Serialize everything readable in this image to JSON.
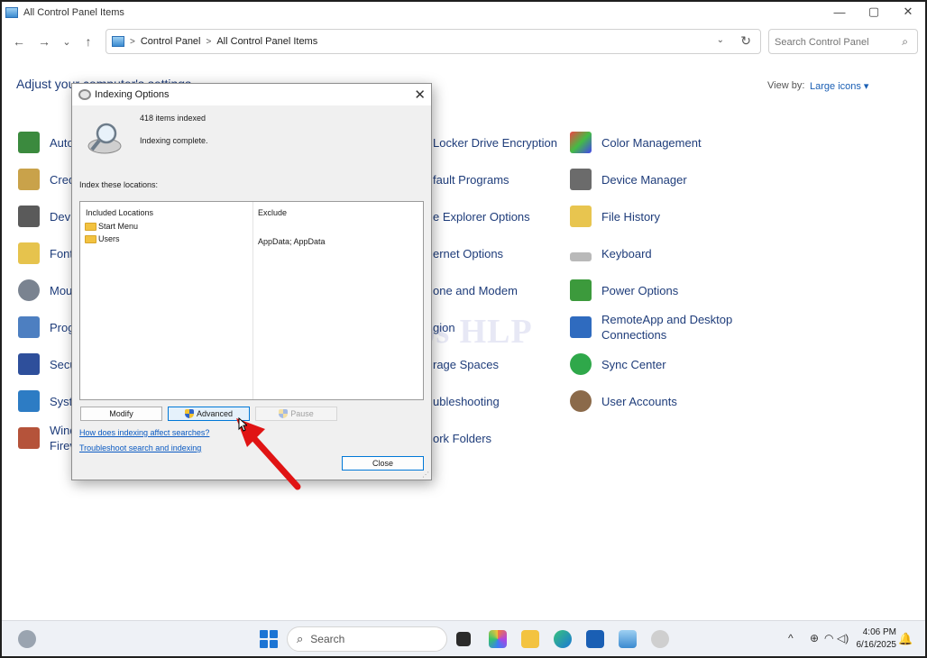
{
  "window": {
    "title": "All Control Panel Items",
    "controls": {
      "minimize": "—",
      "maximize": "▢",
      "close": "✕"
    }
  },
  "nav": {
    "back": "←",
    "forward": "→",
    "recent": "⌄",
    "up": "↑",
    "breadcrumb": [
      "Control Panel",
      "All Control Panel Items"
    ],
    "separator": ">",
    "dropdown": "⌄",
    "refresh": "↻",
    "search_placeholder": "Search Control Panel",
    "search_icon": "⌕"
  },
  "header": {
    "adjust": "Adjust your computer's settings",
    "view_by_label": "View by:",
    "view_by_value": "Large icons ▾"
  },
  "items": {
    "col1": [
      "Auto",
      "Cred",
      "Devi",
      "Font",
      "Mou",
      "Prog",
      "Secu",
      "Syst",
      "Wind\nFirev"
    ],
    "col2": [
      "Locker Drive Encryption",
      "fault Programs",
      "e Explorer Options",
      "ernet Options",
      "one and Modem",
      "gion",
      "rage Spaces",
      "ubleshooting",
      "ork Folders"
    ],
    "col3": [
      "Color Management",
      "Device Manager",
      "File History",
      "Keyboard",
      "Power Options",
      "RemoteApp and Desktop\nConnections",
      "Sync Center",
      "User Accounts"
    ]
  },
  "watermark": "IT Pros HLP",
  "dialog": {
    "title": "Indexing Options",
    "close": "✕",
    "items_indexed": "418 items indexed",
    "status": "Indexing complete.",
    "index_label": "Index these locations:",
    "included_header": "Included Locations",
    "exclude_header": "Exclude",
    "locations": [
      {
        "name": "Start Menu",
        "exclude": ""
      },
      {
        "name": "Users",
        "exclude": "AppData; AppData"
      }
    ],
    "modify": "Modify",
    "advanced": "Advanced",
    "pause": "Pause",
    "link_affect": "How does indexing affect searches?",
    "link_troubleshoot": "Troubleshoot search and indexing",
    "close_button": "Close",
    "grip": "⋰"
  },
  "taskbar": {
    "search": "Search",
    "search_icon": "⌕",
    "tray_chevron": "^",
    "time": "4:06 PM",
    "date": "6/16/2025",
    "bell": "🔔"
  }
}
